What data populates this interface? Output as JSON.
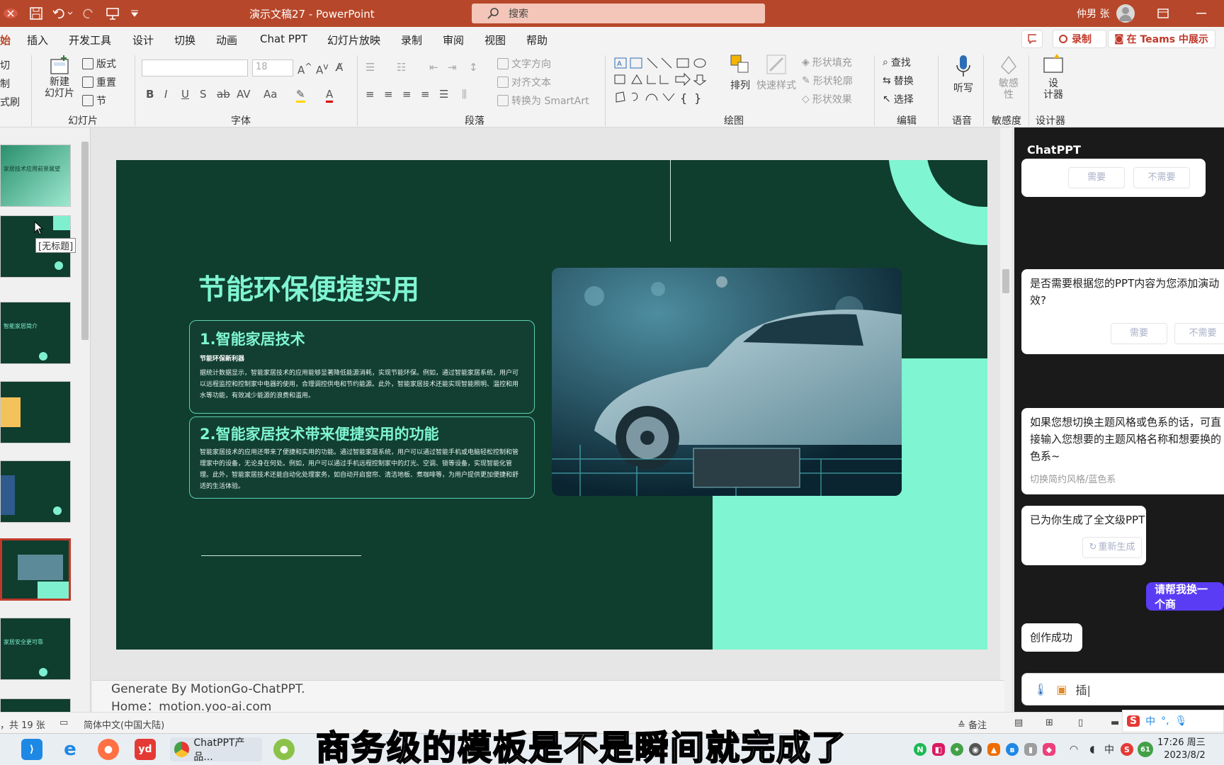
{
  "titlebar": {
    "doc_title": "演示文稿27 - PowerPoint",
    "search_placeholder": "搜索",
    "user_name": "仲男 张"
  },
  "menu": {
    "tabs": [
      "始",
      "插入",
      "开发工具",
      "设计",
      "切换",
      "动画",
      "Chat PPT",
      "幻灯片放映",
      "录制",
      "审阅",
      "视图",
      "帮助"
    ],
    "record_button": "录制",
    "teams_button": "在 Teams 中展示"
  },
  "ribbon": {
    "clipboard": {
      "cut": "切",
      "copy": "制",
      "format": "式刷"
    },
    "slides_group": {
      "new_slide": "新建\n幻灯片",
      "layout": "版式",
      "reset": "重置",
      "section": "节",
      "label": "幻灯片"
    },
    "font_group": {
      "font_name": "",
      "font_size": "18",
      "label": "字体"
    },
    "paragraph_group": {
      "text_direction": "文字方向",
      "align_text": "对齐文本",
      "smartart": "转换为 SmartArt",
      "label": "段落"
    },
    "drawing_group": {
      "arrange": "排列",
      "quick_styles": "快速样式",
      "shape_fill": "形状填充",
      "shape_outline": "形状轮廓",
      "shape_effects": "形状效果",
      "label": "绘图"
    },
    "editing_group": {
      "find": "查找",
      "replace": "替换",
      "select": "选择",
      "label": "编辑"
    },
    "voice_group": {
      "dictate": "听写",
      "label": "语音"
    },
    "sensitivity_group": {
      "sensitivity": "敏感\n性",
      "label": "敏感度"
    },
    "designer_group": {
      "designer": "设\n计器",
      "label": "设计器"
    }
  },
  "thumbnails": {
    "tooltip": "[无标题]",
    "items": [
      {
        "title": "家居技术应用前景展望"
      },
      {
        "title": ""
      },
      {
        "title": "智能家居简介"
      },
      {
        "title": ""
      },
      {
        "title": ""
      },
      {
        "title": ""
      },
      {
        "title": "家居安全更可靠"
      }
    ],
    "selected_index": 5
  },
  "slide": {
    "headline": "节能环保便捷实用",
    "card1": {
      "heading": "1.智能家居技术",
      "subheading": "节能环保新利器",
      "body": "据统计数据显示，智能家居技术的应用能够显著降低能源消耗，实现节能环保。例如，通过智能家居系统，用户可以远程监控和控制家中电器的使用，合理调控供电和节约能源。此外，智能家居技术还能实现智能照明、温控和用水等功能，有效减少能源的浪费和滥用。"
    },
    "card2": {
      "heading": "2.智能家居技术带来便捷实用的功能",
      "body": "智能家居技术的应用还带来了便捷和实用的功能。通过智能家居系统，用户可以通过智能手机或电脑轻松控制和管理家中的设备，无论身在何处。例如，用户可以通过手机远程控制家中的灯光、空调、锁等设备，实现智能化管理。此外，智能家居技术还能自动化处理家务，如自动开启窗帘、清洁地板、煮咖啡等，为用户提供更加便捷和舒适的生活体验。"
    },
    "colors": {
      "background": "#0f3d2e",
      "accent": "#7ff5d1"
    }
  },
  "notes": {
    "line1": "Generate By MotionGo-ChatPPT.",
    "line2": "Home：motion.yoo-ai.com"
  },
  "statusbar": {
    "slide_count": "，共 19 张",
    "language": "简体中文(中国大陆)",
    "notes_button": "备注"
  },
  "chatppt": {
    "panel_title": "ChatPPT",
    "msg1": {
      "yes": "需要",
      "no": "不需要"
    },
    "msg2": {
      "text": "是否需要根据您的PPT内容为您添加演动效?",
      "yes": "需要",
      "no": "不需要"
    },
    "msg3": {
      "text": "如果您想切换主题风格或色系的话，可直接输入您想要的主题风格名称和想要换的色系~",
      "hint": "切换简约风格/蓝色系"
    },
    "msg4": {
      "text": "已为你生成了全文级PPT",
      "regen": "重新生成"
    },
    "user_msg": "请帮我换一个商",
    "msg5": {
      "text": "创作成功"
    },
    "input_value": "插|"
  },
  "taskbar": {
    "chrome_label": "ChatPPT产品...",
    "ime": "中",
    "time": "17:26 周三",
    "date": "2023/8/2"
  },
  "subtitle": "商务级的模板是不是瞬间就完成了"
}
